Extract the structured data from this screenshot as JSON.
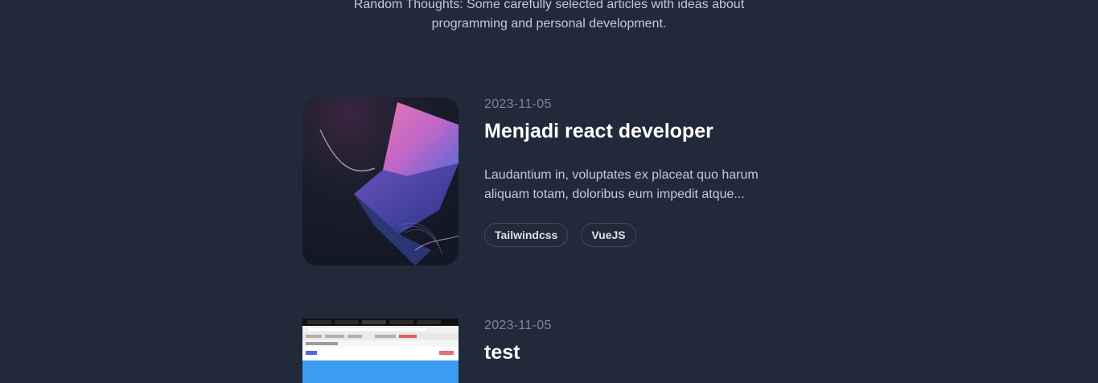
{
  "intro": {
    "line1": "Random Thoughts: Some carefully selected articles with ideas about",
    "line2": "programming and personal development."
  },
  "articles": [
    {
      "date": "2023-11-05",
      "title": "Menjadi react developer",
      "excerpt": "Laudantium in, voluptates ex placeat quo harum aliquam totam, doloribus eum impedit atque...",
      "tags": [
        "Tailwindcss",
        "VueJS"
      ]
    },
    {
      "date": "2023-11-05",
      "title": "test"
    }
  ],
  "colors": {
    "background": "#212a3a",
    "accent_pink": "#e86aa8",
    "accent_blue": "#4a5fd0"
  }
}
